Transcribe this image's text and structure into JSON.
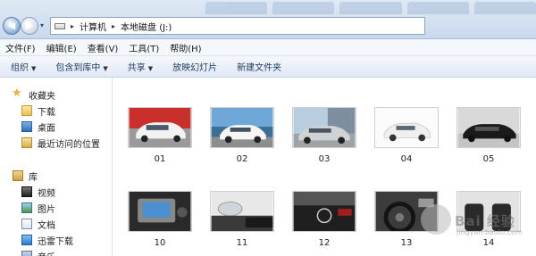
{
  "address": {
    "path": [
      "计算机",
      "本地磁盘 (J:)"
    ]
  },
  "menu": [
    "文件(F)",
    "编辑(E)",
    "查看(V)",
    "工具(T)",
    "帮助(H)"
  ],
  "commands": [
    {
      "label": "组织",
      "dropdown": true
    },
    {
      "label": "包含到库中",
      "dropdown": true
    },
    {
      "label": "共享",
      "dropdown": true
    },
    {
      "label": "放映幻灯片",
      "dropdown": false
    },
    {
      "label": "新建文件夹",
      "dropdown": false
    }
  ],
  "nav": {
    "favorites": {
      "label": "收藏夹",
      "items": [
        "下载",
        "桌面",
        "最近访问的位置"
      ]
    },
    "libraries": {
      "label": "库",
      "items": [
        "视频",
        "图片",
        "文档",
        "迅雷下载",
        "音乐"
      ]
    }
  },
  "files": [
    {
      "name": "01",
      "scene": "white-sedan-front"
    },
    {
      "name": "02",
      "scene": "white-car-coast"
    },
    {
      "name": "03",
      "scene": "silver-car-road"
    },
    {
      "name": "04",
      "scene": "white-car-studio"
    },
    {
      "name": "05",
      "scene": "black-car-studio"
    },
    {
      "name": "10",
      "scene": "dashboard-nav"
    },
    {
      "name": "11",
      "scene": "headlight-grille"
    },
    {
      "name": "12",
      "scene": "dark-rear-logo"
    },
    {
      "name": "13",
      "scene": "steering-wheel"
    },
    {
      "name": "14",
      "scene": "interior-seats"
    }
  ],
  "watermark": {
    "text": "Bai 经验",
    "sub": "jingyan.baidu.com"
  }
}
